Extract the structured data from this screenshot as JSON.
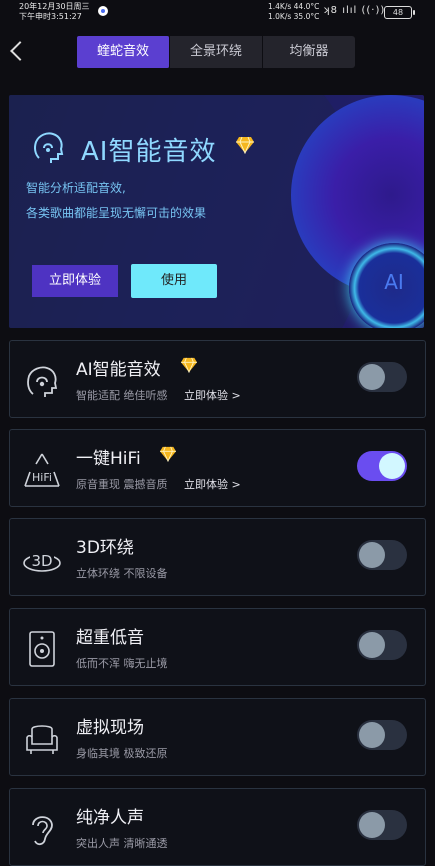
{
  "status": {
    "date": "20年12月30日周三",
    "time": "下午申时3:51:27",
    "net_up": "1.4K/s 44.0°C",
    "net_down": "1.0K/s 35.0°C",
    "signal_icons": "ʞ8 ılıl ((·))",
    "battery": "48"
  },
  "tabs": [
    {
      "label": "蝰蛇音效",
      "active": true
    },
    {
      "label": "全景环绕",
      "active": false
    },
    {
      "label": "均衡器",
      "active": false
    }
  ],
  "hero": {
    "title": "AI智能音效",
    "desc1": "智能分析适配音效,",
    "desc2": "各类歌曲都能呈现无懈可击的效果",
    "try_label": "立即体验",
    "use_label": "使用",
    "disc_text": "AI",
    "title_color": "#8fd8ff",
    "gem_color": "#f5b71f"
  },
  "effects": [
    {
      "icon": "head-ai-icon",
      "title": "AI智能音效",
      "premium": true,
      "sub": "智能适配 绝佳听感",
      "link": "立即体验 >",
      "enabled": false
    },
    {
      "icon": "hifi-icon",
      "title": "一键HiFi",
      "premium": true,
      "sub": "原音重现 震撼音质",
      "link": "立即体验 >",
      "enabled": true
    },
    {
      "icon": "3d-icon",
      "title": "3D环绕",
      "premium": false,
      "sub": "立体环绕 不限设备",
      "link": "",
      "enabled": false
    },
    {
      "icon": "speaker-icon",
      "title": "超重低音",
      "premium": false,
      "sub": "低而不浑 嗨无止境",
      "link": "",
      "enabled": false
    },
    {
      "icon": "armchair-icon",
      "title": "虚拟现场",
      "premium": false,
      "sub": "身临其境 极致还原",
      "link": "",
      "enabled": false
    },
    {
      "icon": "ear-icon",
      "title": "纯净人声",
      "premium": false,
      "sub": "突出人声 清晰通透",
      "link": "",
      "enabled": false
    }
  ],
  "colors": {
    "accent": "#5b3fd0",
    "toggle_on": "#6a4df0",
    "cyan": "#6fe9fb"
  }
}
